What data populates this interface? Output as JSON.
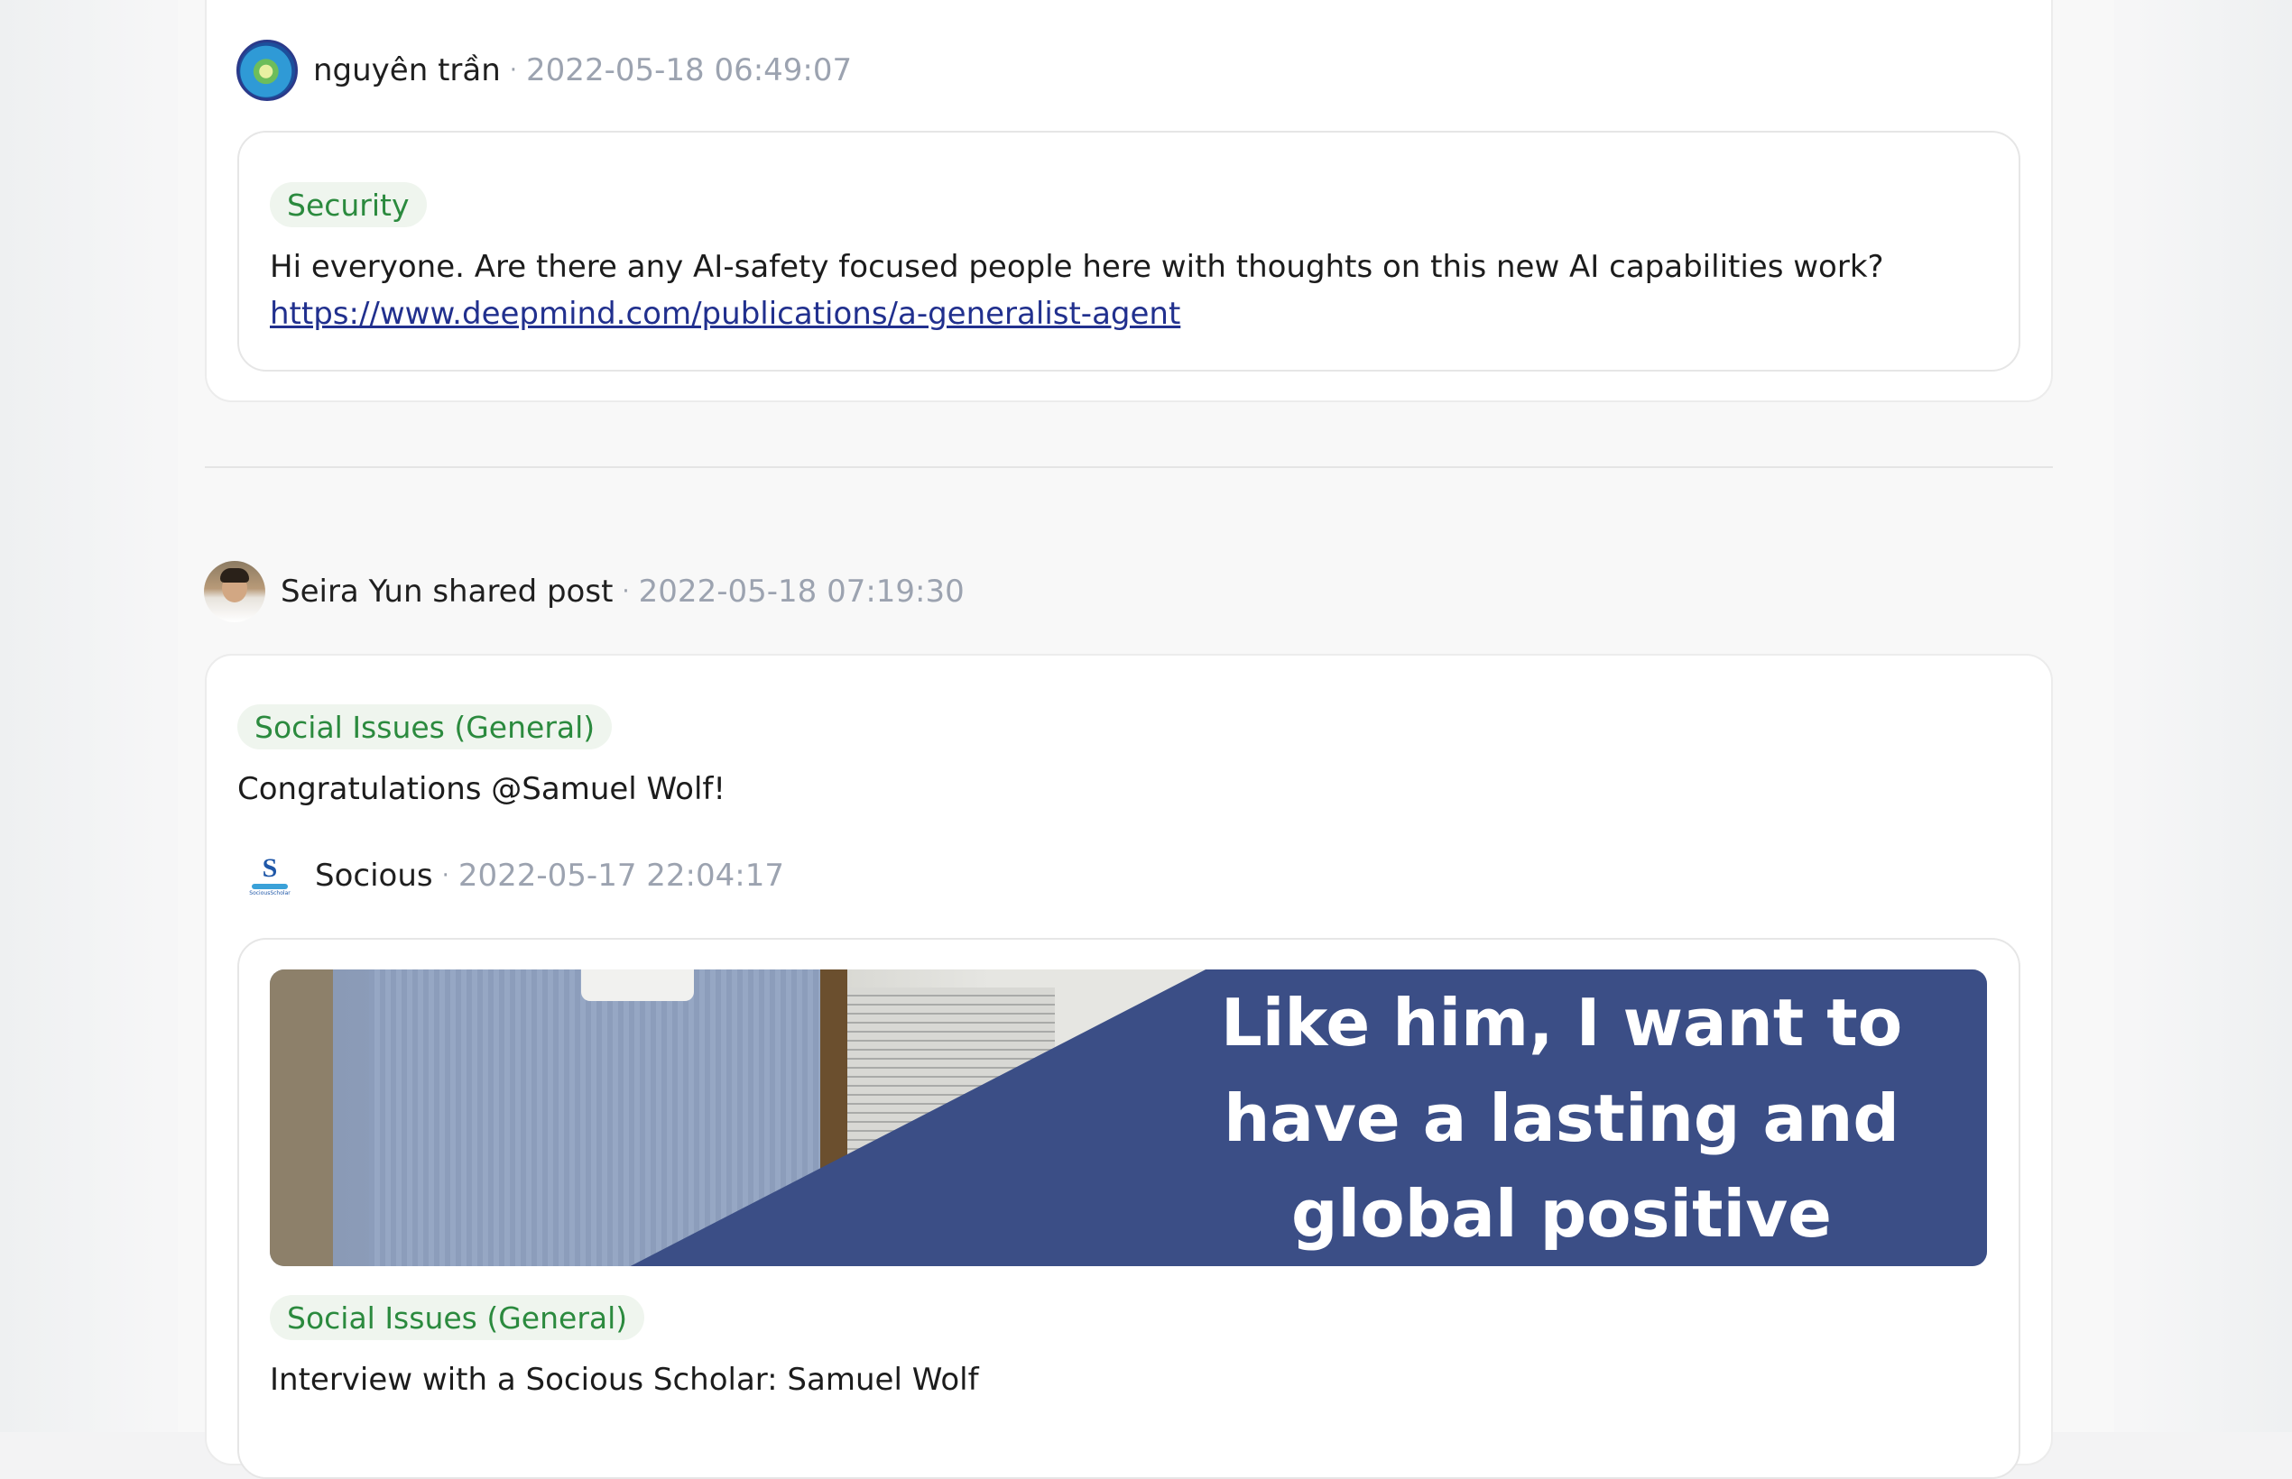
{
  "post1": {
    "author": "nguyên trần",
    "separator": "·",
    "timestamp": "2022-05-18 06:49:07",
    "tag": "Security",
    "body": "Hi everyone. Are there any AI-safety focused people here with thoughts on this new AI capabilities work?",
    "link": "https://www.deepmind.com/publications/a-generalist-agent"
  },
  "post2": {
    "author_line": "Seira Yun shared post",
    "separator": "·",
    "timestamp": "2022-05-18 07:19:30",
    "tag": "Social Issues (General)",
    "body": "Congratulations @Samuel Wolf!",
    "shared": {
      "author": "Socious",
      "logo_letter": "S",
      "logo_caption": "SociousScholar",
      "separator": "·",
      "timestamp": "2022-05-17 22:04:17",
      "banner_lines": [
        "Like him, I want to",
        "have a lasting and",
        "global positive"
      ],
      "tag": "Social Issues (General)",
      "title": "Interview with a Socious Scholar: Samuel Wolf"
    }
  },
  "colors": {
    "tag_text": "#2b8a3e",
    "tag_bg": "#eff5ee",
    "timestamp": "#9ca3b0",
    "link": "#21308e",
    "banner_blue": "#3b4e86"
  }
}
